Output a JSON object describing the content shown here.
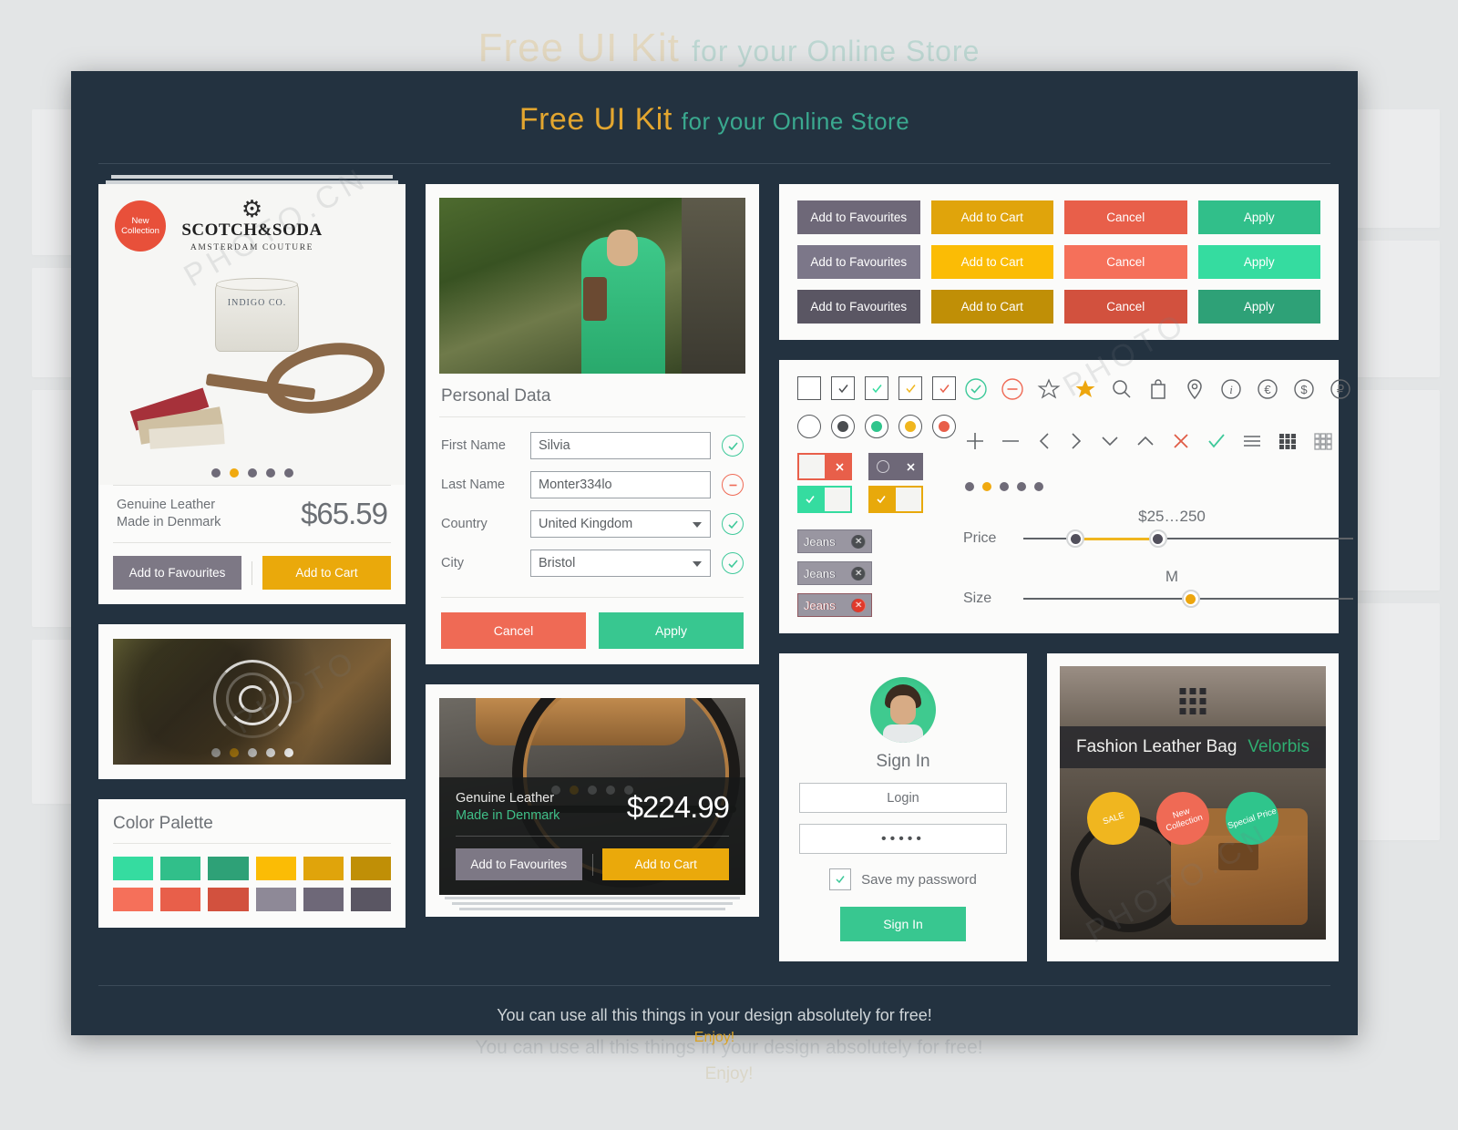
{
  "header": {
    "title_gold": "Free UI Kit",
    "title_teal": "for your Online Store"
  },
  "footer": {
    "line1": "You can use all this things in your design absolutely for free!",
    "line2": "Enjoy!"
  },
  "product_card": {
    "badge": {
      "line1": "New",
      "line2": "Collection"
    },
    "brand_name": "SCOTCH&SODA",
    "brand_sub": "AMSTERDAM COUTURE",
    "tin_label": "INDIGO CO.",
    "desc_line1": "Genuine Leather",
    "desc_line2": "Made in Denmark",
    "price": "$65.59",
    "btn_favourites": "Add to Favourites",
    "btn_cart": "Add to Cart",
    "dots_count": 5,
    "dots_active": 1
  },
  "loader_card": {
    "dots_count": 5,
    "dots_active": 1
  },
  "palette": {
    "title": "Color Palette",
    "row1": [
      "#35dca0",
      "#31bf8a",
      "#2ea177",
      "#fbbc05",
      "#e0a40b",
      "#c08f06"
    ],
    "row2": [
      "#f5705a",
      "#e85f4a",
      "#d2513e",
      "#8e8997",
      "#6e6878",
      "#5a5663"
    ]
  },
  "form": {
    "title": "Personal Data",
    "fields": [
      {
        "label": "First Name",
        "value": "Silvia",
        "type": "text",
        "status": "ok"
      },
      {
        "label": "Last Name",
        "value": "Monter334lo",
        "type": "text",
        "status": "error"
      },
      {
        "label": "Country",
        "value": "United Kingdom",
        "type": "select",
        "status": "ok"
      },
      {
        "label": "City",
        "value": "Bristol",
        "type": "select",
        "status": "ok"
      }
    ],
    "btn_cancel": "Cancel",
    "btn_apply": "Apply"
  },
  "bike_card": {
    "desc_line1": "Genuine Leather",
    "desc_line2": "Made in Denmark",
    "price": "$224.99",
    "btn_favourites": "Add to Favourites",
    "btn_cart": "Add to Cart",
    "dots_count": 5,
    "dots_active": 1
  },
  "button_matrix": {
    "rows": [
      [
        {
          "label": "Add to Favourites",
          "color": "#6e6878"
        },
        {
          "label": "Add to Cart",
          "color": "#e0a40b"
        },
        {
          "label": "Cancel",
          "color": "#e85f4a"
        },
        {
          "label": "Apply",
          "color": "#31bf8a"
        }
      ],
      [
        {
          "label": "Add to Favourites",
          "color": "#7c7789"
        },
        {
          "label": "Add to Cart",
          "color": "#fbbc05"
        },
        {
          "label": "Cancel",
          "color": "#f5705a"
        },
        {
          "label": "Apply",
          "color": "#35dca0"
        }
      ],
      [
        {
          "label": "Add to Favourites",
          "color": "#5a5663"
        },
        {
          "label": "Add to Cart",
          "color": "#c08f06"
        },
        {
          "label": "Cancel",
          "color": "#d2513e"
        },
        {
          "label": "Apply",
          "color": "#2ea177"
        }
      ]
    ]
  },
  "controls": {
    "checkboxes": [
      {
        "state": "empty",
        "color": ""
      },
      {
        "state": "checked",
        "color": "#4a4d50"
      },
      {
        "state": "checked",
        "color": "#35dca0"
      },
      {
        "state": "checked",
        "color": "#f0b61f"
      },
      {
        "state": "checked",
        "color": "#e85f4a"
      }
    ],
    "radios": [
      {
        "state": "empty",
        "color": ""
      },
      {
        "state": "selected",
        "color": "#4a4d50"
      },
      {
        "state": "selected",
        "color": "#2fc58c"
      },
      {
        "state": "selected",
        "color": "#f0b61f"
      },
      {
        "state": "selected",
        "color": "#e85f4a"
      }
    ],
    "toggles": [
      {
        "bg": "#e85f4a",
        "side": "right",
        "glyph": "x",
        "fill": "#ffffff"
      },
      {
        "bg": "#6e6878",
        "side": "right",
        "glyph": "x",
        "fill": "#ffffff"
      },
      {
        "bg": "#35dca0",
        "side": "left",
        "glyph": "check",
        "fill": "#ffffff"
      },
      {
        "bg": "#e8a90b",
        "side": "left",
        "glyph": "check",
        "fill": "#ffffff"
      }
    ],
    "tag_label": "Jeans",
    "tags": [
      {
        "style": "solid",
        "x_color": "#4a4d50"
      },
      {
        "style": "ghost",
        "x_color": "#4a4d50"
      },
      {
        "style": "solid",
        "x_color": "#4a4d50"
      },
      {
        "style": "ghost",
        "x_color": "#4a4d50"
      },
      {
        "style": "solid",
        "x_color": "#e0392b"
      },
      {
        "style": "ghost-red",
        "x_color": "#e0392b"
      }
    ],
    "icons_row1": [
      "check-circle-icon",
      "minus-circle-icon",
      "star-outline-icon",
      "star-filled-icon",
      "search-icon",
      "shopping-bag-icon",
      "map-pin-icon",
      "info-circle-icon",
      "euro-circle-icon",
      "dollar-circle-icon",
      "ruble-circle-icon"
    ],
    "icons_row2": [
      "plus-icon",
      "minus-icon",
      "chevron-left-icon",
      "chevron-right-icon",
      "chevron-down-icon",
      "chevron-up-icon",
      "close-icon",
      "check-icon",
      "list-view-icon",
      "grid-view-icon",
      "grid-outline-icon"
    ],
    "pager_dots": 5,
    "pager_active": 1,
    "price_slider": {
      "label": "Price",
      "value": "$25…250",
      "low_pct": 18,
      "high_pct": 43
    },
    "size_slider": {
      "label": "Size",
      "value": "M",
      "pos_pct": 50
    }
  },
  "signin": {
    "title": "Sign In",
    "login_placeholder": "Login",
    "password_value": "•••••",
    "save_password_label": "Save my password",
    "button": "Sign In"
  },
  "bag_card": {
    "title": "Fashion Leather Bag",
    "brand": "Velorbis",
    "badges": [
      {
        "label": "SALE",
        "color": "#f0b61f"
      },
      {
        "label": "New Collection",
        "color": "#ef6a55"
      },
      {
        "label": "Special Price",
        "color": "#2fc58c"
      }
    ]
  },
  "theme": {
    "panel_bg": "#233240",
    "card_bg": "#fbfbfa",
    "gold": "#e3a62f",
    "teal": "#3aa98f",
    "red": "#e85f4a",
    "grey": "#6e6878"
  }
}
